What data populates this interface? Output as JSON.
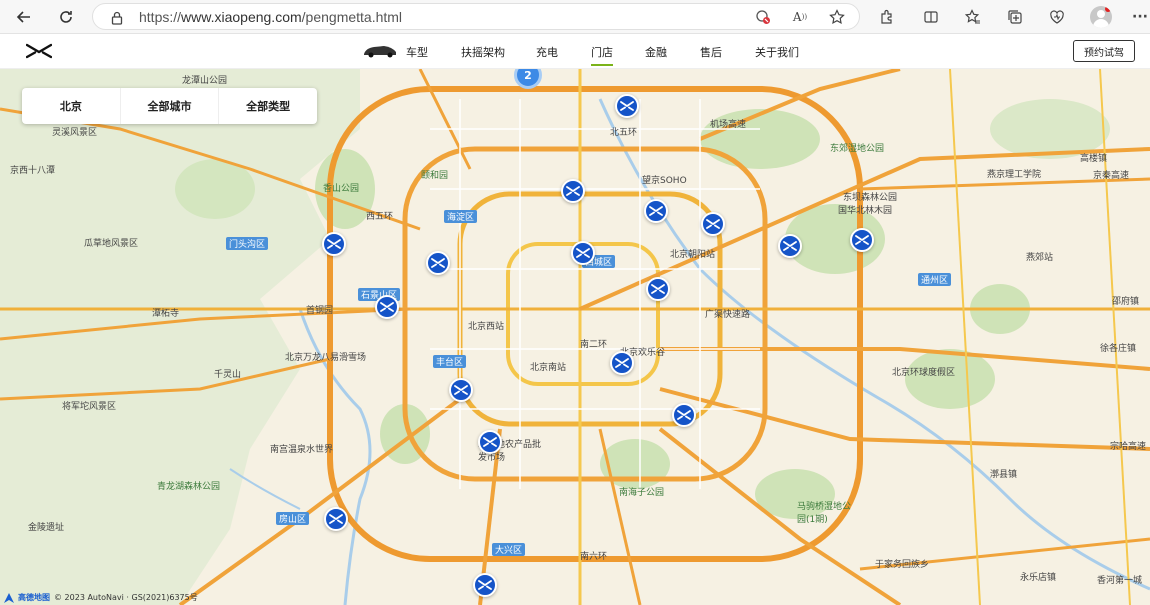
{
  "browser": {
    "url_scheme": "https://",
    "url_host": "www.xiaopeng.com",
    "url_path": "/pengmetta.html",
    "icons": [
      "back-icon",
      "refresh-icon",
      "lock-icon",
      "tracking-blocked-icon",
      "read-aloud-icon",
      "favorite-star-icon",
      "extensions-icon",
      "split-screen-icon",
      "favorites-icon",
      "collections-icon",
      "browser-essentials-icon",
      "profile-avatar",
      "more-icon"
    ]
  },
  "header": {
    "nav": [
      "车型",
      "扶摇架构",
      "充电",
      "门店",
      "金融",
      "售后",
      "关于我们"
    ],
    "active_nav": "门店",
    "book_button": "预约试驾"
  },
  "filters": [
    "北京",
    "全部城市",
    "全部类型"
  ],
  "map": {
    "cluster_count": "2",
    "attribution_brand": "高德地图",
    "attribution_text": "© 2023 AutoNavi · GS(2021)6375号",
    "labels": {
      "l1": "龙潭山公园",
      "l2": "灵溪风景区",
      "l3": "京西十八潭",
      "l4": "瓜草地风景区",
      "l5": "潭柘寺",
      "l6": "千灵山",
      "l7": "将军坨风景区",
      "l8": "北京万龙八易滑雪场",
      "l9": "南宫温泉水世界",
      "l10": "青龙湖森林公园",
      "l11": "金陵遗址",
      "l12": "香山公园",
      "l13": "颐和园",
      "l14": "西五环",
      "l15": "首钢园",
      "l16": "北京西站",
      "l17": "北京南站",
      "l18": "南二环",
      "l19": "北京欢乐谷",
      "l20": "广渠快速路",
      "l21": "北京朝阳站",
      "l22": "望京SOHO",
      "l23": "东郊湿地公园",
      "l24": "东坝森林公园",
      "l25": "国华北林木园",
      "l26": "燕京理工学院",
      "l27": "燕郊站",
      "l28": "北京环球度假区",
      "l29": "新发地农产品批发市场",
      "l30": "南海子公园",
      "l31": "马驹桥湿地公园(1期)",
      "l32": "北五环",
      "l33": "机场高速",
      "l34": "香河第一城",
      "l35": "高楼镇",
      "l36": "邵府镇",
      "l37": "徐各庄镇",
      "l38": "永乐店镇",
      "l39": "于家务回族乡",
      "l40": "漷县镇",
      "l41": "宗哈高速",
      "l42": "南六环",
      "l43": "京秦高速"
    },
    "districts": {
      "d1": "门头沟区",
      "d2": "石景山区",
      "d3": "海淀区",
      "d4": "丰台区",
      "d5": "房山区",
      "d6": "大兴区",
      "d7": "通州区",
      "d8": "西城区"
    }
  }
}
